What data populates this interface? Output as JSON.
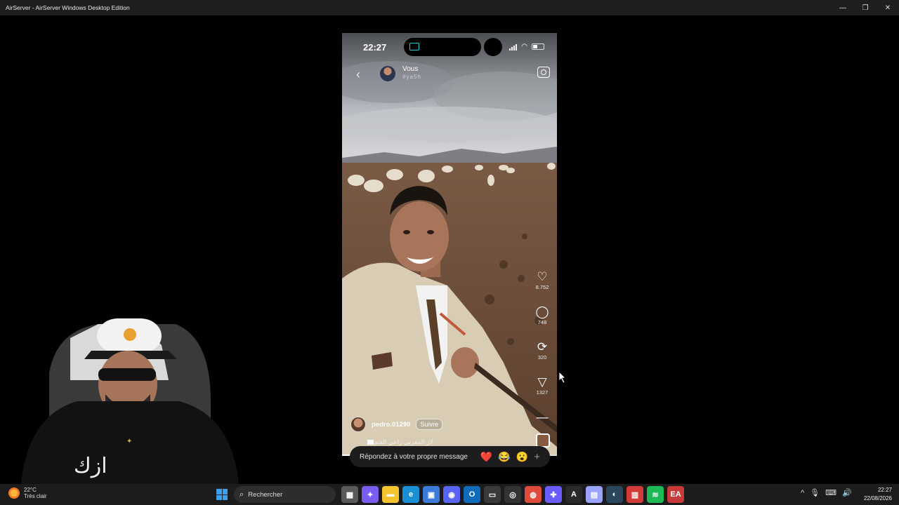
{
  "window": {
    "title": "AirServer - AirServer Windows Desktop Edition",
    "minimize": "—",
    "maximize": "❐",
    "close": "✕"
  },
  "phone": {
    "status_time": "22:27",
    "profile": {
      "name": "Vous",
      "sub": "#ya5h"
    },
    "actions": [
      {
        "icon": "heart-icon",
        "glyph": "♡",
        "count": "8.752"
      },
      {
        "icon": "comment-icon",
        "glyph": "◯",
        "count": "748"
      },
      {
        "icon": "repost-icon",
        "glyph": "⟳",
        "count": "320"
      },
      {
        "icon": "share-icon",
        "glyph": "▽",
        "count": "1327"
      },
      {
        "icon": "more-icon",
        "glyph": "—",
        "count": ""
      }
    ],
    "author": {
      "name": "pedro.01290",
      "follow": "Suivre"
    },
    "caption": "لاز المغربي راعي الغنم"
  },
  "reply": {
    "placeholder": "Répondez à votre propre message",
    "emojis": [
      "❤️",
      "😂",
      "😮"
    ],
    "plus": "+"
  },
  "taskbar": {
    "weather": {
      "temp": "22°C",
      "desc": "Très clair"
    },
    "search_label": "Rechercher",
    "search_icon": "⌕",
    "apps": [
      {
        "name": "task-view",
        "glyph": "▦",
        "color": "#5a5a5a"
      },
      {
        "name": "copilot",
        "glyph": "✦",
        "color": "#7b5cf0"
      },
      {
        "name": "file-explorer",
        "glyph": "▬",
        "color": "#f4c430"
      },
      {
        "name": "edge",
        "glyph": "e",
        "color": "#1b8fd6"
      },
      {
        "name": "store",
        "glyph": "▣",
        "color": "#3b7ad8"
      },
      {
        "name": "discord",
        "glyph": "◉",
        "color": "#5865f2"
      },
      {
        "name": "outlook",
        "glyph": "O",
        "color": "#0f6cbd"
      },
      {
        "name": "airserver",
        "glyph": "▭",
        "color": "#3a3a3a"
      },
      {
        "name": "obs",
        "glyph": "◎",
        "color": "#333333"
      },
      {
        "name": "chrome",
        "glyph": "◍",
        "color": "#e04a3a"
      },
      {
        "name": "gamepad",
        "glyph": "✚",
        "color": "#6b5cff"
      },
      {
        "name": "vector-app",
        "glyph": "A",
        "color": "#2a2a2a"
      },
      {
        "name": "messenger",
        "glyph": "▤",
        "color": "#9aa3ff"
      },
      {
        "name": "steam",
        "glyph": "◐",
        "color": "#2a475e"
      },
      {
        "name": "news",
        "glyph": "▥",
        "color": "#d33a3a"
      },
      {
        "name": "spotify",
        "glyph": "≋",
        "color": "#1db954"
      },
      {
        "name": "ea",
        "glyph": "EA",
        "color": "#c83a3a"
      }
    ],
    "tray": [
      "^",
      "🎙",
      "⌨",
      "🔊"
    ],
    "clock_time": "22:27",
    "clock_date": "22/08/2026"
  }
}
